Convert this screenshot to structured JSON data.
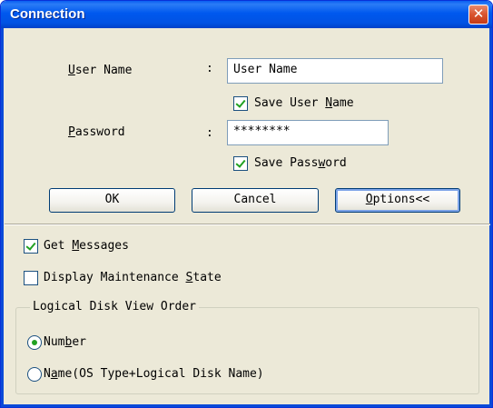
{
  "window": {
    "title": "Connection",
    "close_glyph": "✕"
  },
  "user_name": {
    "label": "User Name",
    "colon": ":",
    "value": "User Name"
  },
  "save_user_name": {
    "label": "Save User Name",
    "checked": true
  },
  "password": {
    "label": "Password",
    "colon": ":",
    "value": "********"
  },
  "save_password": {
    "label": "Save Password",
    "checked": true
  },
  "buttons": {
    "ok": "OK",
    "cancel": "Cancel",
    "options": "Options<<"
  },
  "get_messages": {
    "label": "Get Messages",
    "checked": true
  },
  "display_maintenance": {
    "label": "Display Maintenance State",
    "checked": false
  },
  "view_order": {
    "legend": "Logical Disk View Order",
    "options": [
      {
        "label": "Number",
        "selected": true
      },
      {
        "label": "Name(OS Type+Logical Disk Name)",
        "selected": false
      }
    ]
  },
  "colors": {
    "title_bar": "#0058ee",
    "dialog_bg": "#ece9d8",
    "check_mark": "#21a121",
    "close_button": "#d9542f"
  }
}
